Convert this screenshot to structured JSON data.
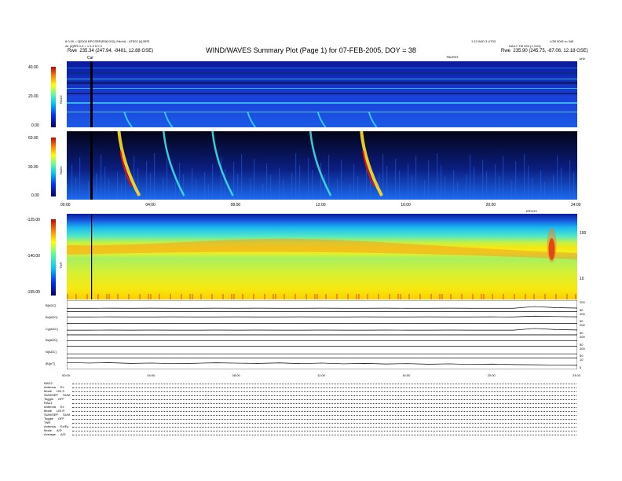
{
  "header": {
    "left_line1": "6.0.00 = 0[2000 BPCSRP(R08 002) (%to%) - ATE02 [4] BPE",
    "left_line2": "A1 [4]RR-0-3 = 1 5 0 5 0 0",
    "left_rx_prefix": "Rwe",
    "left_rx_value": "235.34 (247.94, -8481, 12.88 GSE)",
    "title": "WIND/WAVES Summary Plot (Page 1) for 07-FEB-2005, DOY = 38",
    "mid_right": "1.13 WIO 3 UT03",
    "mid_small": "TBURST",
    "right_line1": "LOB 5001 m 3d3",
    "right_line2": "DAILY TM 393 (1,3.04)",
    "right_rx_prefix": "Rwe",
    "right_rx_value": "235.90 (245.75, -87.06, 12.18 GSE)",
    "cal_label": "Cal",
    "corner_label": "kHz"
  },
  "chart_data": [
    {
      "type": "heatmap",
      "panel": "RAD2",
      "ylabel": "RAD2",
      "colorbar_ticks": [
        "40.00",
        "20.00",
        "0.00"
      ],
      "colormap": [
        "#05006b",
        "#0030ff",
        "#00c8ff",
        "#60ff90",
        "#ffff00",
        "#ff8000",
        "#c80000"
      ],
      "bursts_hours": [
        2.7,
        4.6,
        8.5,
        11.8,
        14.2
      ]
    },
    {
      "type": "heatmap",
      "panel": "RAD1",
      "ylabel": "RAD1",
      "colorbar_ticks": [
        "60.00",
        "30.00",
        "0.00"
      ],
      "x_ticks": [
        "00:00",
        "04:00",
        "08:00",
        "12:00",
        "16:00",
        "20:00",
        "24:00"
      ],
      "bursts_hours": [
        2.6,
        4.7,
        7.0,
        11.6,
        14.0
      ],
      "xlim": [
        0,
        24
      ]
    },
    {
      "type": "heatmap",
      "panel": "TNR",
      "ylabel": "TNR",
      "colorbar_ticks": [
        "-125.00",
        "-140.00",
        "-155.00"
      ],
      "right_ticks": [
        "100",
        "10"
      ],
      "right_label": "ERVOX",
      "event_hour": 22.8,
      "xlim": [
        0,
        24
      ]
    },
    {
      "type": "line",
      "panel": "magnetic-field",
      "rows": [
        {
          "label": "B[ADC]",
          "values": [
            0.3,
            0.3,
            0.31,
            0.3,
            0.31,
            0.3,
            0.3,
            0.31,
            0.3,
            0.31,
            0.3,
            0.3,
            0.31,
            0.3,
            0.3,
            0.31,
            0.3,
            0.3,
            0.31,
            0.3,
            0.3,
            0.3,
            0.45,
            0.35,
            0.32
          ],
          "right_ticks": [
            "200",
            "50"
          ]
        },
        {
          "label": "Bx[ADC]",
          "values": [
            0.55,
            0.55,
            0.56,
            0.55,
            0.55,
            0.56,
            0.55,
            0.55,
            0.56,
            0.55,
            0.55,
            0.56,
            0.55,
            0.55,
            0.56,
            0.55,
            0.55,
            0.56,
            0.55,
            0.55,
            0.56,
            0.55,
            0.62,
            0.58,
            0.56
          ],
          "right_ticks": [
            "200",
            "50"
          ]
        },
        {
          "label": "Cy[ADC]",
          "values": [
            0.4,
            0.4,
            0.41,
            0.4,
            0.41,
            0.4,
            0.4,
            0.41,
            0.4,
            0.41,
            0.4,
            0.4,
            0.41,
            0.4,
            0.4,
            0.41,
            0.4,
            0.4,
            0.41,
            0.4,
            0.4,
            0.4,
            0.55,
            0.45,
            0.42
          ],
          "right_ticks": [
            "200",
            "50"
          ]
        },
        {
          "label": "Bz[ADC]",
          "values": [
            0.5,
            0.5,
            0.5,
            0.5,
            0.5,
            0.5,
            0.5,
            0.5,
            0.5,
            0.5,
            0.5,
            0.5,
            0.5,
            0.5,
            0.5,
            0.5,
            0.5,
            0.5,
            0.5,
            0.5,
            0.5,
            0.5,
            0.5,
            0.5,
            0.5
          ],
          "right_ticks": [
            "200",
            "50"
          ]
        },
        {
          "label": "N[ADC]",
          "values": [
            0.35,
            0.35,
            0.35,
            0.35,
            0.35,
            0.35,
            0.35,
            0.35,
            0.35,
            0.35,
            0.35,
            0.35,
            0.35,
            0.35,
            0.35,
            0.35,
            0.35,
            0.35,
            0.35,
            0.35,
            0.35,
            0.35,
            0.35,
            0.35,
            0.35
          ],
          "right_ticks": [
            "200",
            "50"
          ]
        },
        {
          "label": "|B|[nT]",
          "values": [
            0.6,
            0.55,
            0.58,
            0.52,
            0.55,
            0.5,
            0.53,
            0.57,
            0.54,
            0.52,
            0.56,
            0.5,
            0.55,
            0.48,
            0.52,
            0.47,
            0.5,
            0.45,
            0.48,
            0.43,
            0.46,
            0.42,
            0.4,
            0.38,
            0.36
          ],
          "right_ticks": [
            "10",
            "5"
          ]
        }
      ],
      "x_ticks": [
        "00:00",
        "04:00",
        "08:00",
        "12:00",
        "16:00",
        "20:00",
        "24:00"
      ],
      "xlim": [
        0,
        24
      ]
    }
  ],
  "footer": [
    {
      "k": "RAD2",
      "v": ""
    },
    {
      "k": "Antenna",
      "v": "Ex"
    },
    {
      "k": "Mode",
      "v": "LIN S"
    },
    {
      "k": "SUM/SEP",
      "v": "SUM"
    },
    {
      "k": "Toggle",
      "v": "OFF"
    },
    {
      "k": "RAD1",
      "v": ""
    },
    {
      "k": "Antenna",
      "v": "Ex"
    },
    {
      "k": "Mode",
      "v": "LIN R"
    },
    {
      "k": "SUM/SEP",
      "v": "SUM"
    },
    {
      "k": "Toggle",
      "v": "OFF"
    },
    {
      "k": "TNR",
      "v": ""
    },
    {
      "k": "Antenna",
      "v": "Ex/Ey"
    },
    {
      "k": "Mode",
      "v": "A/D"
    },
    {
      "k": "Average",
      "v": "A/D"
    }
  ]
}
